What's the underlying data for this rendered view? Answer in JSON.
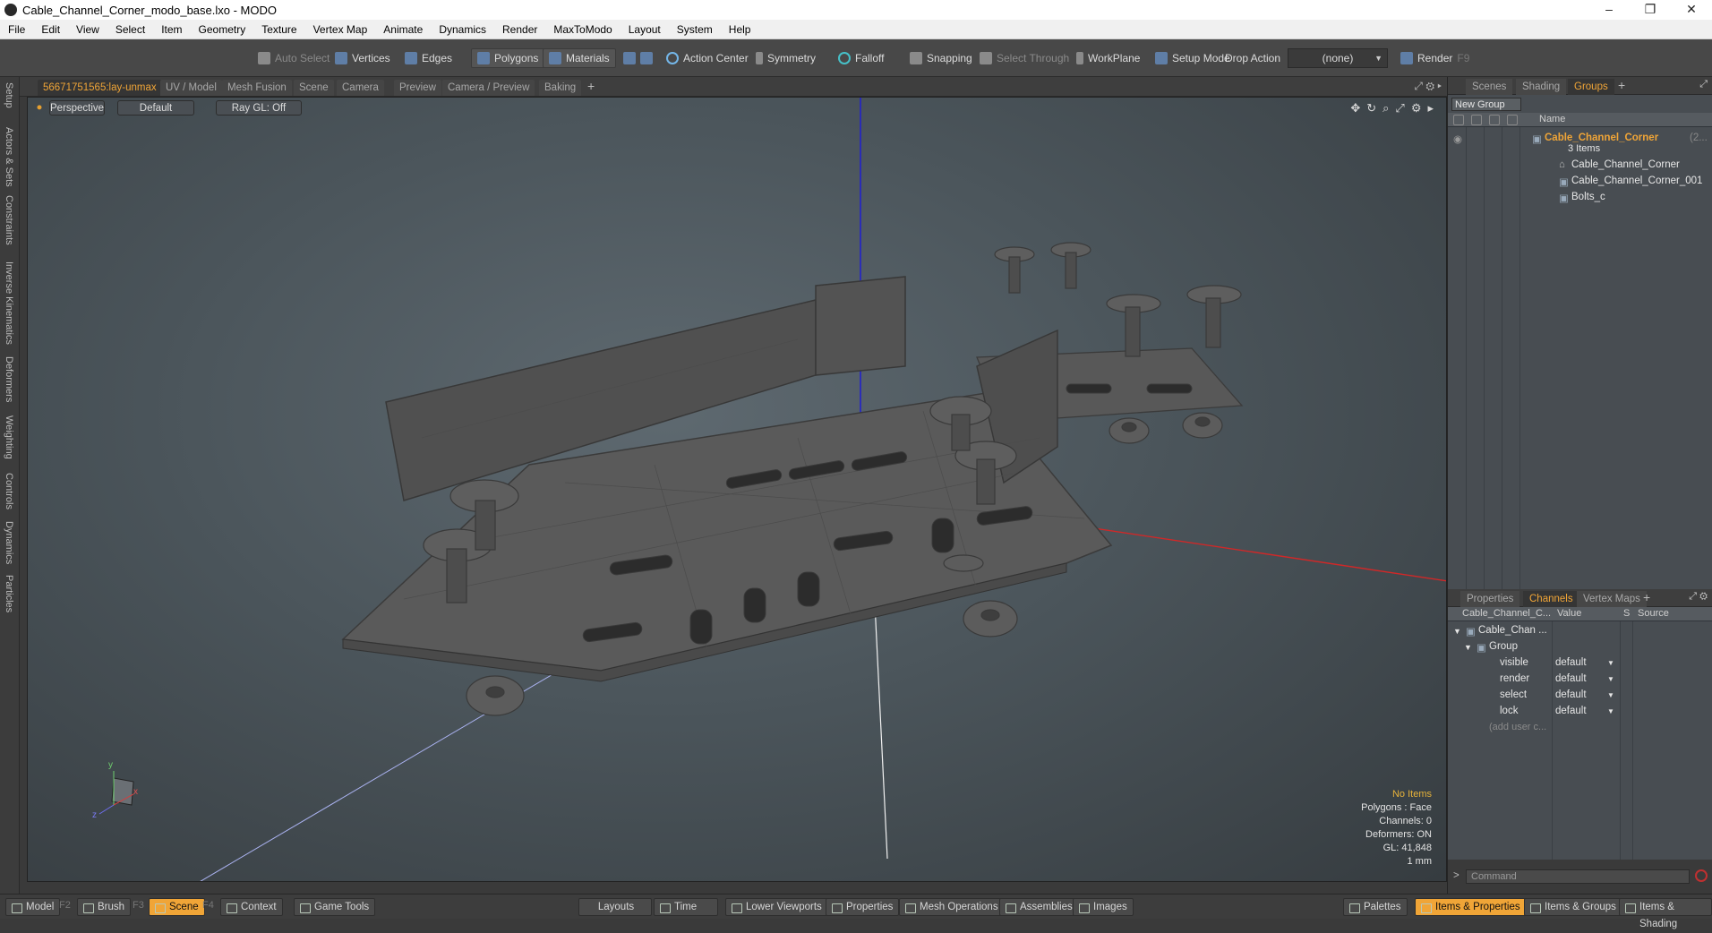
{
  "window": {
    "title": "Cable_Channel_Corner_modo_base.lxo - MODO",
    "minimize_icon": "–",
    "restore_icon": "❐",
    "close_icon": "✕"
  },
  "menu": [
    "File",
    "Edit",
    "View",
    "Select",
    "Item",
    "Geometry",
    "Texture",
    "Vertex Map",
    "Animate",
    "Dynamics",
    "Render",
    "MaxToModo",
    "Layout",
    "System",
    "Help"
  ],
  "toolbar": {
    "auto_select": "Auto Select",
    "vertices": "Vertices",
    "edges": "Edges",
    "polygons": "Polygons",
    "materials": "Materials",
    "action_center": "Action Center",
    "symmetry": "Symmetry",
    "falloff": "Falloff",
    "snapping": "Snapping",
    "select_through": "Select Through",
    "workplane": "WorkPlane",
    "setup_mode": "Setup Mode",
    "drop_action": "Drop Action",
    "drop_value": "(none)",
    "render": "Render",
    "render_key": "F9"
  },
  "left_tabs": [
    "Setup",
    "Actors & Sets",
    "Constraints",
    "Inverse Kinematics",
    "Deformers",
    "Weighting",
    "Controls",
    "Dynamics",
    "Particles"
  ],
  "viewport_tabs": [
    "56671751565:lay-unmax",
    "UV / Model",
    "Mesh Fusion",
    "Scene",
    "Camera",
    "Preview",
    "Camera / Preview",
    "Baking"
  ],
  "viewport": {
    "view_mode": "Perspective",
    "shading": "Default",
    "raygl": "Ray GL: Off",
    "axis_y": "y",
    "axis_x": "x",
    "axis_z": "z"
  },
  "stats": {
    "selection": "No Items",
    "polygons": "Polygons : Face",
    "channels": "Channels: 0",
    "deformers": "Deformers: ON",
    "gl": "GL: 41,848",
    "unit": "1 mm"
  },
  "right_tabs": [
    "Scenes",
    "Shading",
    "Groups"
  ],
  "groups": {
    "new_group": "New Group",
    "name_header": "Name",
    "root": "Cable_Channel_Corner",
    "root_suffix": "(2...",
    "count": "3 Items",
    "children": [
      "Cable_Channel_Corner",
      "Cable_Channel_Corner_001",
      "Bolts_c"
    ]
  },
  "channels": {
    "tabs": [
      "Properties",
      "Channels",
      "Vertex Maps"
    ],
    "col_name": "Cable_Channel_C...",
    "col_value": "Value",
    "col_s": "S",
    "col_source": "Source",
    "item": "Cable_Chan ...",
    "group": "Group",
    "rows": [
      {
        "name": "visible",
        "value": "default"
      },
      {
        "name": "render",
        "value": "default"
      },
      {
        "name": "select",
        "value": "default"
      },
      {
        "name": "lock",
        "value": "default"
      }
    ],
    "add_user": "(add user c..."
  },
  "command": {
    "prompt": ">",
    "placeholder": "Command"
  },
  "statusbar": {
    "model": "Model",
    "model_key": "F2",
    "brush": "Brush",
    "brush_key": "F3",
    "scene": "Scene",
    "scene_key": "F4",
    "context": "Context",
    "game_tools": "Game Tools",
    "layouts": "Layouts",
    "time": "Time",
    "lower_viewports": "Lower Viewports",
    "properties": "Properties",
    "mesh_operations": "Mesh Operations",
    "assemblies": "Assemblies",
    "images": "Images",
    "palettes": "Palettes",
    "items_properties": "Items & Properties",
    "items_groups": "Items & Groups",
    "items_shading": "Items & Shading"
  },
  "colors": {
    "accent": "#f0a537",
    "x_axis": "#d02828",
    "y_axis": "#2222cc",
    "z_axis": "#aab2f0"
  }
}
